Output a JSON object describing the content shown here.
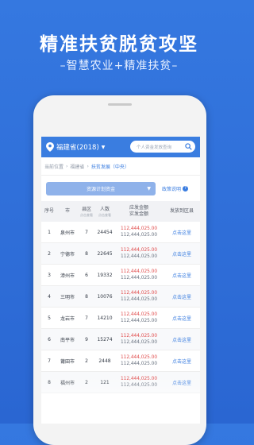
{
  "banner": {
    "headline": "精准扶贫脱贫攻坚",
    "subline": "–智慧农业+精准扶贫–"
  },
  "appbar": {
    "province": "福建省(2018)",
    "search_placeholder": "个人资金发放查询"
  },
  "breadcrumb": {
    "home": "当前位置",
    "level1": "福建省",
    "current": "扶贫发展（中央）"
  },
  "filter": {
    "dropdown_label": "资源计划资金",
    "policy_link": "政策说明"
  },
  "table": {
    "headers": {
      "no": "序号",
      "city": "市",
      "county": "县区",
      "county_sub": "点击查看",
      "people": "人数",
      "people_sub": "点击查看",
      "amount_top": "应发金额",
      "amount_bottom": "实发金额",
      "release": "发放到区县"
    },
    "rows": [
      {
        "no": "1",
        "city": "泉州市",
        "county": "7",
        "people": "24454",
        "amount1": "112,444,025.00",
        "amount2": "112,444,025.00",
        "action": "点击这里"
      },
      {
        "no": "2",
        "city": "宁德市",
        "county": "8",
        "people": "22645",
        "amount1": "112,444,025.00",
        "amount2": "112,444,025.00",
        "action": "点击这里"
      },
      {
        "no": "3",
        "city": "漳州市",
        "county": "6",
        "people": "19332",
        "amount1": "112,444,025.00",
        "amount2": "112,444,025.00",
        "action": "点击这里"
      },
      {
        "no": "4",
        "city": "三明市",
        "county": "8",
        "people": "10076",
        "amount1": "112,444,025.00",
        "amount2": "112,444,025.00",
        "action": "点击这里"
      },
      {
        "no": "5",
        "city": "龙岩市",
        "county": "7",
        "people": "14210",
        "amount1": "112,444,025.00",
        "amount2": "112,444,025.00",
        "action": "点击这里"
      },
      {
        "no": "6",
        "city": "南平市",
        "county": "9",
        "people": "15274",
        "amount1": "112,444,025.00",
        "amount2": "112,444,025.00",
        "action": "点击这里"
      },
      {
        "no": "7",
        "city": "莆田市",
        "county": "2",
        "people": "2448",
        "amount1": "112,444,025.00",
        "amount2": "112,444,025.00",
        "action": "点击这里"
      },
      {
        "no": "8",
        "city": "福州市",
        "county": "2",
        "people": "121",
        "amount1": "112,444,025.00",
        "amount2": "112,444,025.00",
        "action": "点击这里"
      }
    ]
  },
  "colors": {
    "background": "#2e6fd9",
    "accent": "#3a7de0",
    "amount_red": "#e04848"
  }
}
